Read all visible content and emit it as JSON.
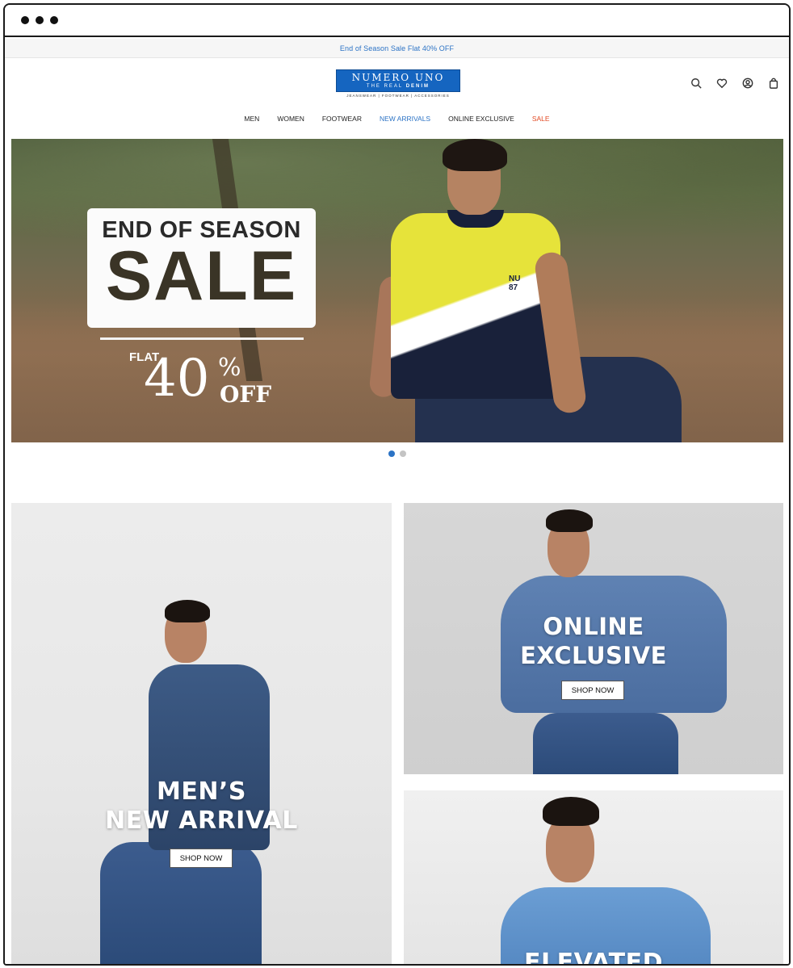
{
  "announcement": "End of Season Sale Flat 40% OFF",
  "logo": {
    "main": "NUMERO UNO",
    "sub_prefix": "THE REAL",
    "sub_bold": "DENIM",
    "tagline": "JEANSWEAR | FOOTWEAR | ACCESSORIES"
  },
  "header_icons": [
    "search-icon",
    "heart-icon",
    "user-icon",
    "bag-icon"
  ],
  "nav": {
    "men": "MEN",
    "women": "WOMEN",
    "footwear": "FOOTWEAR",
    "new_arrivals": "NEW ARRIVALS",
    "online_exclusive": "ONLINE EXCLUSIVE",
    "sale": "SALE"
  },
  "hero": {
    "top": "END OF SEASON",
    "big": "SALE",
    "flat": "FLAT",
    "forty": "40",
    "percent": "%",
    "off": "OFF",
    "shirt_print": "NU 87",
    "slides": 2,
    "active_slide": 1
  },
  "tiles": {
    "mens_line1": "MEN’S",
    "mens_line2": "NEW ARRIVAL",
    "mens_button": "SHOP NOW",
    "online_line1": "ONLINE",
    "online_line2": "EXCLUSIVE",
    "online_button": "SHOP NOW",
    "elevated": "ELEVATED"
  },
  "colors": {
    "accent_blue": "#2c73c5",
    "sale_red": "#e24a24",
    "logo_blue": "#1565c0"
  }
}
